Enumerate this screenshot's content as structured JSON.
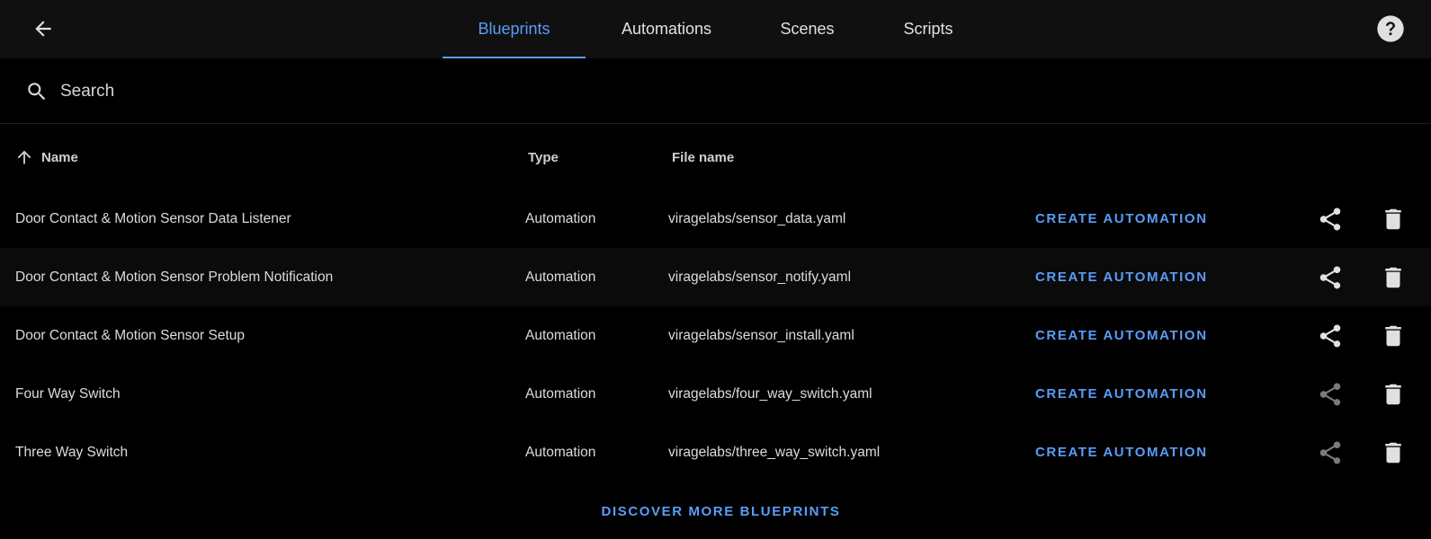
{
  "header": {
    "back_icon": "arrow-left-icon",
    "help_icon": "help-circle-icon",
    "tabs": [
      {
        "label": "Blueprints",
        "active": true
      },
      {
        "label": "Automations",
        "active": false
      },
      {
        "label": "Scenes",
        "active": false
      },
      {
        "label": "Scripts",
        "active": false
      }
    ]
  },
  "search": {
    "placeholder": "Search",
    "value": ""
  },
  "table": {
    "columns": {
      "name": "Name",
      "type": "Type",
      "file_name": "File name"
    },
    "sort": {
      "column": "name",
      "direction": "ascending"
    },
    "rows": [
      {
        "name": "Door Contact & Motion Sensor Data Listener",
        "type": "Automation",
        "file": "viragelabs/sensor_data.yaml",
        "action": "CREATE AUTOMATION",
        "share_enabled": true
      },
      {
        "name": "Door Contact & Motion Sensor Problem Notification",
        "type": "Automation",
        "file": "viragelabs/sensor_notify.yaml",
        "action": "CREATE AUTOMATION",
        "share_enabled": true
      },
      {
        "name": "Door Contact & Motion Sensor Setup",
        "type": "Automation",
        "file": "viragelabs/sensor_install.yaml",
        "action": "CREATE AUTOMATION",
        "share_enabled": true
      },
      {
        "name": "Four Way Switch",
        "type": "Automation",
        "file": "viragelabs/four_way_switch.yaml",
        "action": "CREATE AUTOMATION",
        "share_enabled": false
      },
      {
        "name": "Three Way Switch",
        "type": "Automation",
        "file": "viragelabs/three_way_switch.yaml",
        "action": "CREATE AUTOMATION",
        "share_enabled": false
      }
    ]
  },
  "footer": {
    "discover_label": "DISCOVER MORE BLUEPRINTS"
  },
  "colors": {
    "accent": "#5a9cf8",
    "background": "#000000",
    "topbar": "#101010",
    "icon_enabled": "#e0e0e0",
    "icon_disabled": "#7a7a7a"
  }
}
